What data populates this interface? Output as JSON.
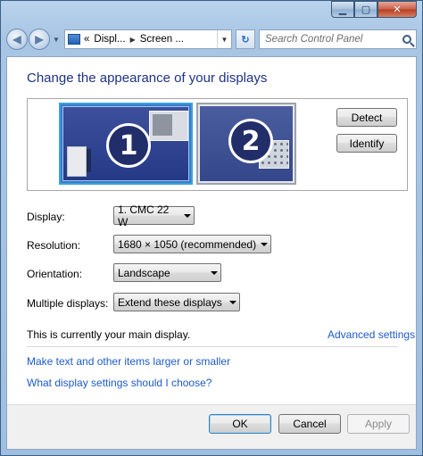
{
  "window": {
    "caption": {
      "minimize": "▁",
      "maximize": "▢",
      "close": "✕"
    }
  },
  "nav": {
    "back": "◀",
    "forward": "▶",
    "recent": "▼",
    "breadcrumbs": [
      "«",
      "Displ...",
      "Screen ..."
    ],
    "crumb_sep": "▶",
    "dropdown": "▼",
    "refresh": "↻",
    "search_placeholder": "Search Control Panel"
  },
  "main": {
    "heading": "Change the appearance of your displays",
    "monitors": [
      {
        "number": "1",
        "selected": true
      },
      {
        "number": "2",
        "selected": false
      }
    ],
    "detect_label": "Detect",
    "identify_label": "Identify",
    "display": {
      "label": "Display:",
      "value": "1. CMC 22 W"
    },
    "resolution": {
      "label": "Resolution:",
      "value": "1680 × 1050 (recommended)"
    },
    "orientation": {
      "label": "Orientation:",
      "value": "Landscape"
    },
    "multiple": {
      "label": "Multiple displays:",
      "value": "Extend these displays"
    },
    "main_display_note": "This is currently your main display.",
    "advanced_link": "Advanced settings",
    "text_size_link": "Make text and other items larger or smaller",
    "help_link": "What display settings should I choose?"
  },
  "footer": {
    "ok": "OK",
    "cancel": "Cancel",
    "apply": "Apply",
    "apply_enabled": false
  },
  "colors": {
    "heading": "#1e3287",
    "link": "#1d5bc8",
    "selected_monitor_border": "#38a3e0"
  }
}
